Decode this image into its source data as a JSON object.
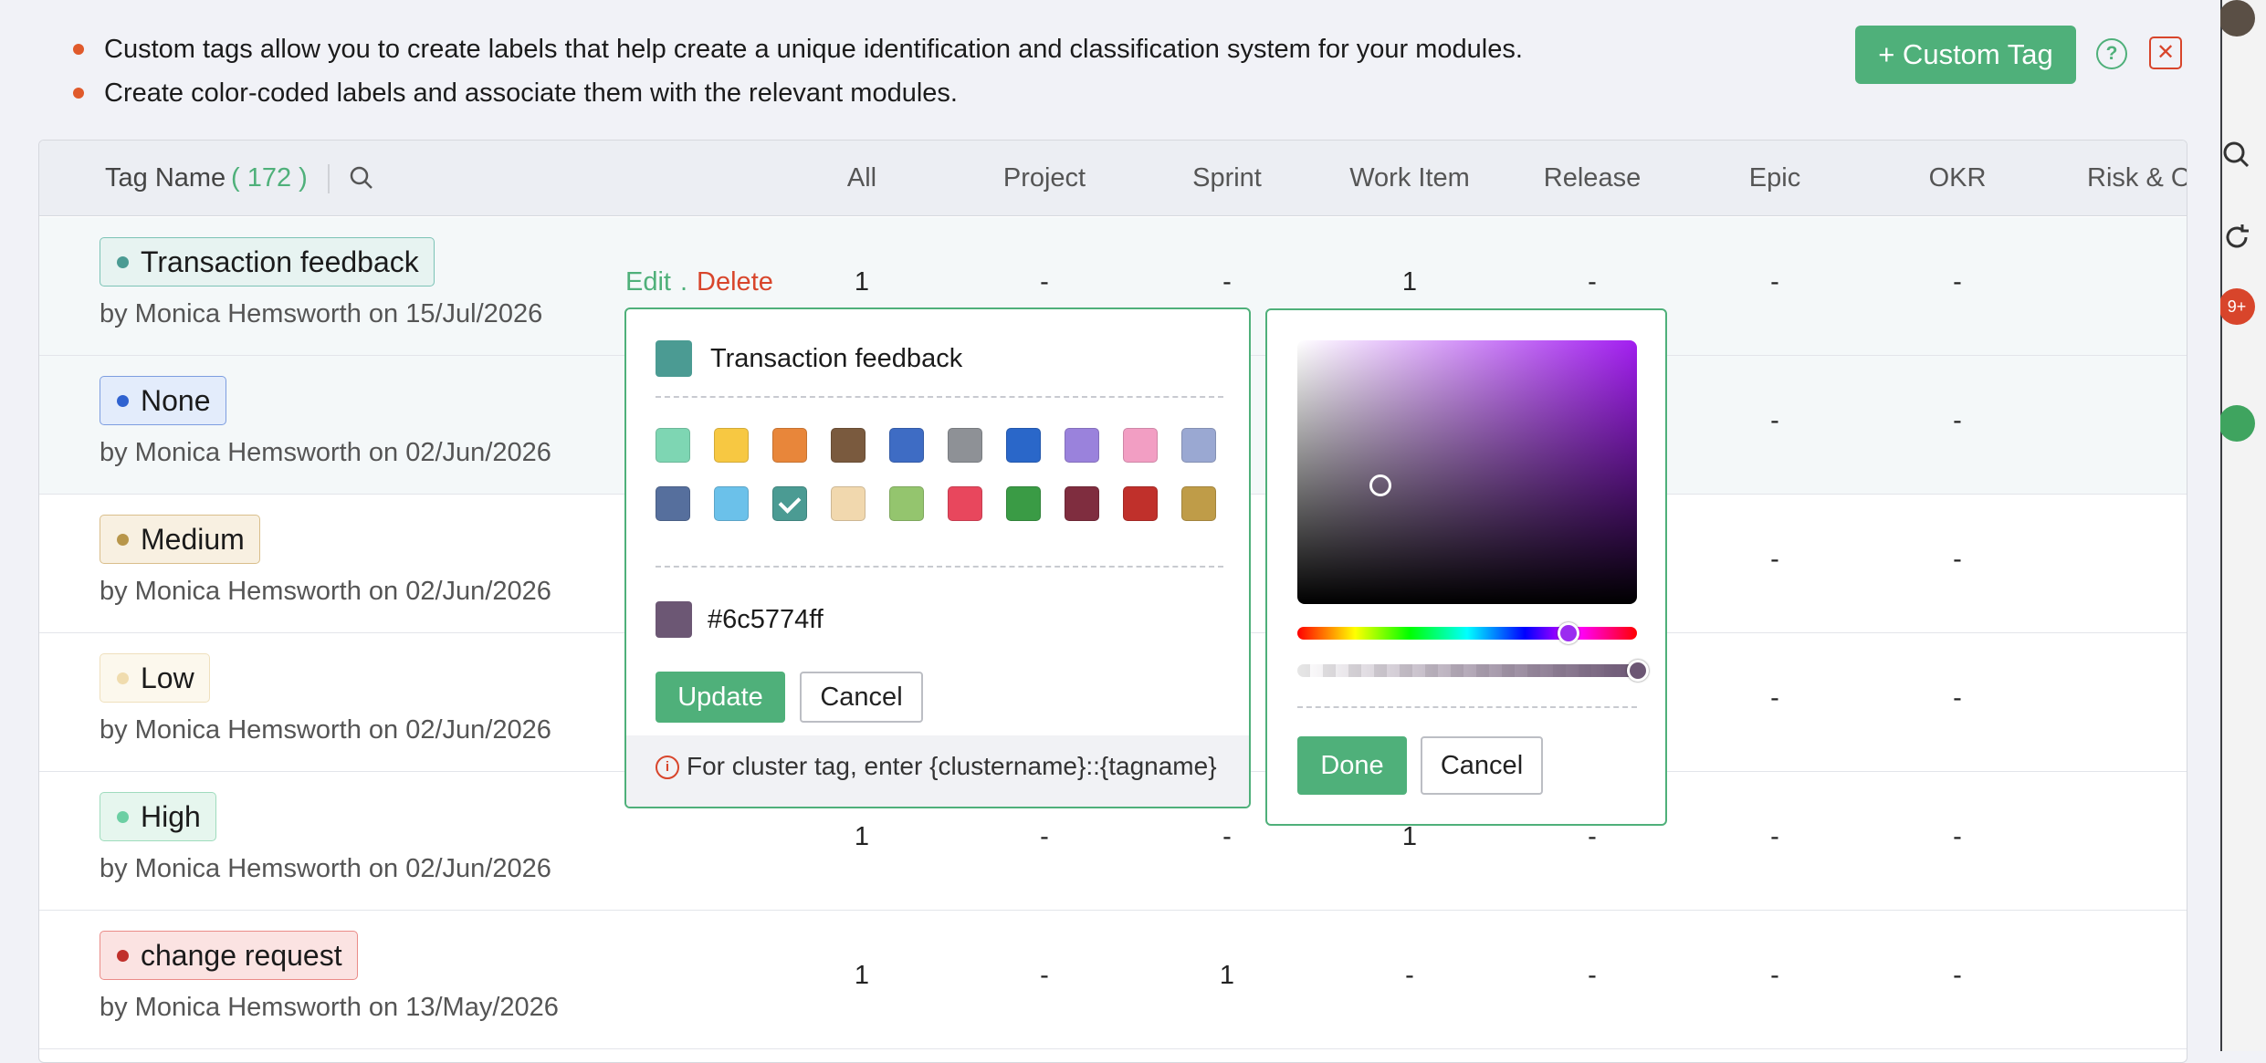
{
  "info": {
    "bullets": [
      "Custom tags allow you to create labels that help create a unique identification and classification system for your modules.",
      "Create color-coded labels and associate them with the relevant modules."
    ]
  },
  "toolbar": {
    "add_label": "+ Custom Tag",
    "help_icon": "help-circle-icon",
    "close_icon": "close-icon"
  },
  "table": {
    "header": {
      "name_label": "Tag Name",
      "count": "( 172 )",
      "columns": [
        "All",
        "Project",
        "Sprint",
        "Work Item",
        "Release",
        "Epic",
        "OKR",
        "Risk & O"
      ]
    },
    "row_actions": {
      "edit": "Edit",
      "separator": ".",
      "delete": "Delete"
    },
    "rows": [
      {
        "name": "Transaction feedback",
        "byline": "by Monica Hemsworth on 15/Jul/2026",
        "tag_bg": "#e7f3f1",
        "tag_border": "#7cc3b6",
        "dot": "#4b9b93",
        "values": [
          "1",
          "-",
          "-",
          "1",
          "-",
          "-",
          "-"
        ]
      },
      {
        "name": "None",
        "byline": "by Monica Hemsworth on 02/Jun/2026",
        "tag_bg": "#e3ecfb",
        "tag_border": "#7d9ee0",
        "dot": "#2f62d0",
        "values": [
          "",
          "",
          "",
          "",
          "",
          "-",
          "-"
        ]
      },
      {
        "name": "Medium",
        "byline": "by Monica Hemsworth on 02/Jun/2026",
        "tag_bg": "#f8f0e1",
        "tag_border": "#d9be8b",
        "dot": "#b8964a",
        "values": [
          "",
          "",
          "",
          "",
          "",
          "-",
          "-"
        ]
      },
      {
        "name": "Low",
        "byline": "by Monica Hemsworth on 02/Jun/2026",
        "tag_bg": "#fcf8ed",
        "tag_border": "#efe0bd",
        "dot": "#f0dcae",
        "values": [
          "",
          "",
          "",
          "",
          "",
          "-",
          "-"
        ]
      },
      {
        "name": "High",
        "byline": "by Monica Hemsworth on 02/Jun/2026",
        "tag_bg": "#e6f6ee",
        "tag_border": "#9fdcbd",
        "dot": "#6ccfa3",
        "values": [
          "1",
          "-",
          "-",
          "1",
          "-",
          "-",
          "-"
        ]
      },
      {
        "name": "change request",
        "byline": "by Monica Hemsworth on 13/May/2026",
        "tag_bg": "#fbe3e2",
        "tag_border": "#ea8c88",
        "dot": "#c0302b",
        "values": [
          "1",
          "-",
          "1",
          "-",
          "-",
          "-",
          "-"
        ]
      }
    ]
  },
  "edit_popup": {
    "tag_name": "Transaction feedback",
    "swatches": [
      "#7ed6b3",
      "#f7c842",
      "#e8863a",
      "#7a5a3e",
      "#3e6cc4",
      "#8e9196",
      "#2a67c9",
      "#9a82dc",
      "#f29ec3",
      "#9aa8d2",
      "#566f9d",
      "#6bc1ea",
      "#4b9b93",
      "#f1d8ae",
      "#94c56e",
      "#e8475d",
      "#3a9b45",
      "#7f2d3f",
      "#c0302b",
      "#bf9c48"
    ],
    "selected_swatch_index": 12,
    "hex_value": "#6c5774ff",
    "update_label": "Update",
    "cancel_label": "Cancel",
    "note": "For cluster tag, enter {clustername}::{tagname}"
  },
  "color_picker": {
    "hue_color": "#a21ef0",
    "alpha_percent": 100,
    "done_label": "Done",
    "cancel_label": "Cancel"
  },
  "extension_badge": "9+"
}
